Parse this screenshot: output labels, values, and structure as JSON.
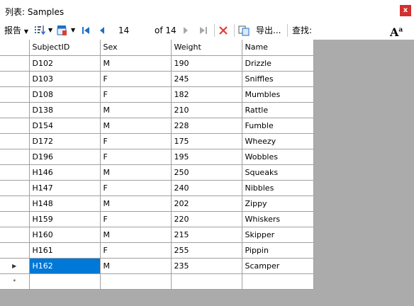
{
  "window": {
    "title": "列表: Samples",
    "close_label": "x"
  },
  "toolbar": {
    "report_label": "报告",
    "position_value": "14",
    "total_label": "of 14",
    "export_label": "导出...",
    "search_label": "查找:",
    "font_label": "A"
  },
  "grid": {
    "columns": [
      "SubjectID",
      "Sex",
      "Weight",
      "Name"
    ],
    "rows": [
      [
        "D102",
        "M",
        "190",
        "Drizzle"
      ],
      [
        "D103",
        "F",
        "245",
        "Sniffles"
      ],
      [
        "D108",
        "F",
        "182",
        "Mumbles"
      ],
      [
        "D138",
        "M",
        "210",
        "Rattle"
      ],
      [
        "D154",
        "M",
        "228",
        "Fumble"
      ],
      [
        "D172",
        "F",
        "175",
        "Wheezy"
      ],
      [
        "D196",
        "F",
        "195",
        "Wobbles"
      ],
      [
        "H146",
        "M",
        "250",
        "Squeaks"
      ],
      [
        "H147",
        "F",
        "240",
        "Nibbles"
      ],
      [
        "H148",
        "M",
        "202",
        "Zippy"
      ],
      [
        "H159",
        "F",
        "220",
        "Whiskers"
      ],
      [
        "H160",
        "M",
        "215",
        "Skipper"
      ],
      [
        "H161",
        "F",
        "255",
        "Pippin"
      ],
      [
        "H162",
        "M",
        "235",
        "Scamper"
      ]
    ],
    "current_row": 13,
    "current_marker": "▶",
    "new_row_marker": "*"
  },
  "colors": {
    "selection": "#0078d7",
    "delete_icon": "#e53935",
    "nav_icon": "#1e6ec8"
  },
  "icons": [
    "close-icon",
    "sort-icon",
    "filter-icon",
    "first-record-icon",
    "previous-record-icon",
    "next-record-icon",
    "last-record-icon",
    "delete-icon",
    "copy-icon",
    "font-size-icon"
  ]
}
